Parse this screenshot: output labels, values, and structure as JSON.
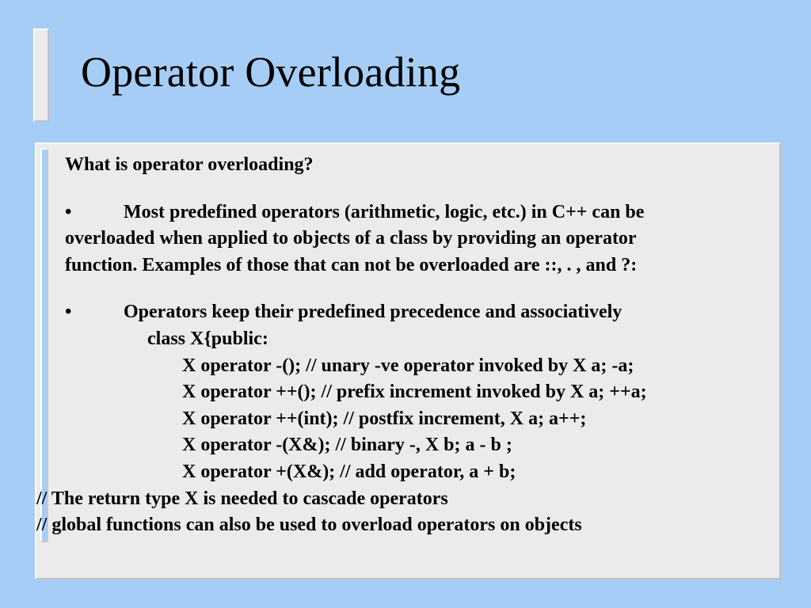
{
  "title": "Operator Overloading",
  "heading": "What is operator overloading?",
  "bullet1_lead": "•",
  "bullet1_text_line1": "Most predefined operators (arithmetic, logic, etc.) in C++ can be",
  "bullet1_text_line2": "overloaded when applied to objects of  a class by providing an operator",
  "bullet1_text_line3": "function. Examples of those that can not  be overloaded are ::, . ,  and ?:",
  "bullet2_lead": "•",
  "bullet2_text": "Operators keep their predefined precedence and associatively",
  "code": {
    "l1": "class X{public:",
    "l2": "X operator -(); // unary -ve operator invoked by X a; -a;",
    "l3": "X operator ++(); // prefix increment invoked by X a; ++a;",
    "l4": "X operator ++(int); // postfix increment, X a; a++;",
    "l5": "X operator -(X&); // binary -, X b; a - b ;",
    "l6": "X operator +(X&); // add operator,  a + b;"
  },
  "tail1": "// The return type X is needed to cascade operators",
  "tail2": "// global functions can also be used to overload operators on objects"
}
